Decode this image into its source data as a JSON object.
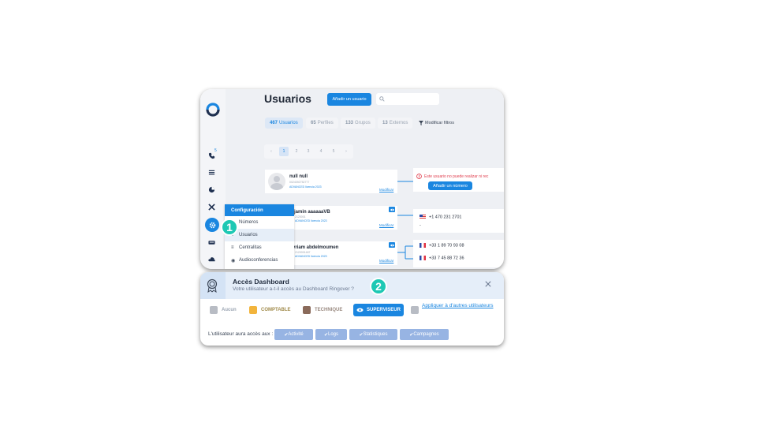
{
  "users_page": {
    "title": "Usuarios",
    "add_user_button": "Añadir un usuario",
    "filters": [
      {
        "count": "467",
        "label": "Usuarios"
      },
      {
        "count": "65",
        "label": "Perfiles"
      },
      {
        "count": "133",
        "label": "Grupos"
      },
      {
        "count": "13",
        "label": "Externos"
      }
    ],
    "modify_filters": "Modificar filtros",
    "pagination": [
      "‹",
      "1",
      "2",
      "3",
      "4",
      "5",
      "›"
    ],
    "nav_badge": "5",
    "users": [
      {
        "name": "null null",
        "sub": "0024392752777",
        "license": "ADVANCED licencia 2023",
        "modify": "Modificar"
      },
      {
        "name": "enjamin aaaaaaVB",
        "sub": "2120001",
        "license": "ADVANCED licencia 2023",
        "modify": "Modificar"
      },
      {
        "name": "yriam abdelmoumen",
        "sub": "2120001467",
        "license": "ADVANCED licencia 2023",
        "modify": "Modificar"
      }
    ],
    "warning_text": "Este usuario no puede realizar ni rec",
    "add_number_button": "Añadir un número",
    "phones": [
      "+1 470 231 2701",
      "-",
      "+33 1 89 70 93 08",
      "+33 7 45 88 72 36"
    ],
    "config_menu": {
      "header": "Configuración",
      "items": [
        "Números",
        "Usuarios",
        "Centralitas",
        "Audioconferencias"
      ]
    }
  },
  "dashboard_access": {
    "title": "Accès Dashboard",
    "subtitle": "Votre utilisateur a-t-il accès au Dashboard Ringover ?",
    "roles": [
      "Aucun",
      "COMPTABLE",
      "TECHNIQUE",
      "SUPERVISEUR"
    ],
    "selected_role": "SUPERVISEUR",
    "apply_link": "Appliquer à d'autres utilisateurs",
    "access_label": "L'utilisateur aura accès aux :",
    "access_items": [
      "Activité",
      "Logs",
      "Statistiques",
      "Campagnes"
    ]
  },
  "step_badges": [
    "1",
    "2"
  ],
  "colors": {
    "accent": "#1a86e0",
    "badge": "#1ec8b4",
    "chip": "#97b4e3",
    "warning": "#e04050"
  },
  "icons": [
    "ringover-logo-icon",
    "phone-icon",
    "list-icon",
    "chart-icon",
    "tools-icon",
    "gear-icon",
    "keyboard-icon",
    "cloud-icon",
    "search-icon",
    "filter-icon",
    "eye-icon",
    "warning-icon",
    "medal-icon",
    "close-icon",
    "check-icon"
  ]
}
